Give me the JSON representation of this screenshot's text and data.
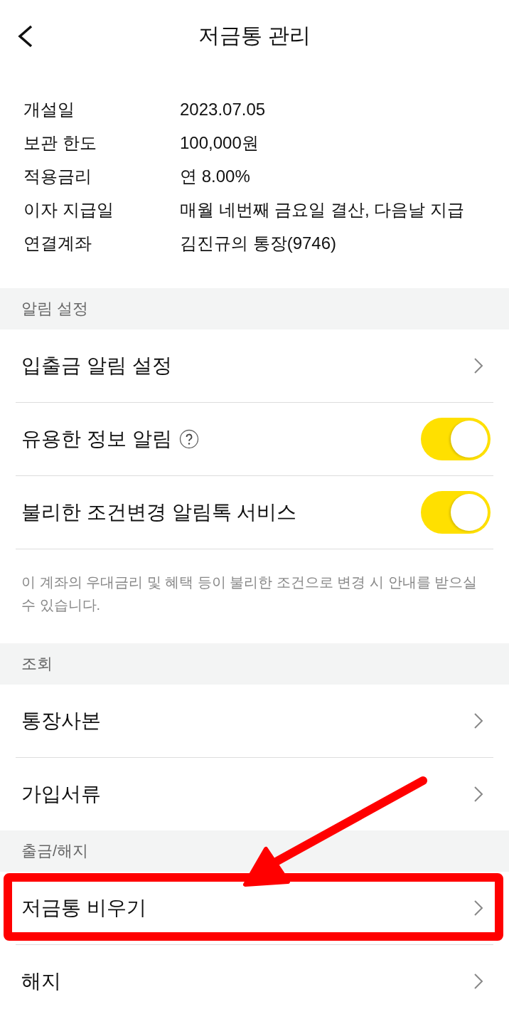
{
  "header": {
    "title": "저금통 관리"
  },
  "info": [
    {
      "label": "개설일",
      "value": "2023.07.05"
    },
    {
      "label": "보관 한도",
      "value": "100,000원"
    },
    {
      "label": "적용금리",
      "value": "연 8.00%"
    },
    {
      "label": "이자 지급일",
      "value": "매월 네번째 금요일 결산, 다음날 지급"
    },
    {
      "label": "연결계좌",
      "value": "김진규의 통장(9746)"
    }
  ],
  "sections": [
    {
      "title": "알림 설정",
      "items": [
        {
          "kind": "link",
          "label": "입출금 알림 설정",
          "help": false,
          "highlighted": false
        },
        {
          "kind": "toggle",
          "label": "유용한 정보 알림",
          "help": true,
          "on": true
        },
        {
          "kind": "toggle",
          "label": "불리한 조건변경 알림톡 서비스",
          "help": false,
          "on": true
        }
      ],
      "note": "이 계좌의 우대금리 및 혜택 등이 불리한 조건으로 변경 시 안내를 받으실 수 있습니다."
    },
    {
      "title": "조회",
      "items": [
        {
          "kind": "link",
          "label": "통장사본",
          "help": false,
          "highlighted": false
        },
        {
          "kind": "link",
          "label": "가입서류",
          "help": false,
          "highlighted": false
        }
      ]
    },
    {
      "title": "출금/해지",
      "items": [
        {
          "kind": "link",
          "label": "저금통 비우기",
          "help": false,
          "highlighted": true
        },
        {
          "kind": "link",
          "label": "해지",
          "help": false,
          "highlighted": false
        }
      ]
    }
  ]
}
